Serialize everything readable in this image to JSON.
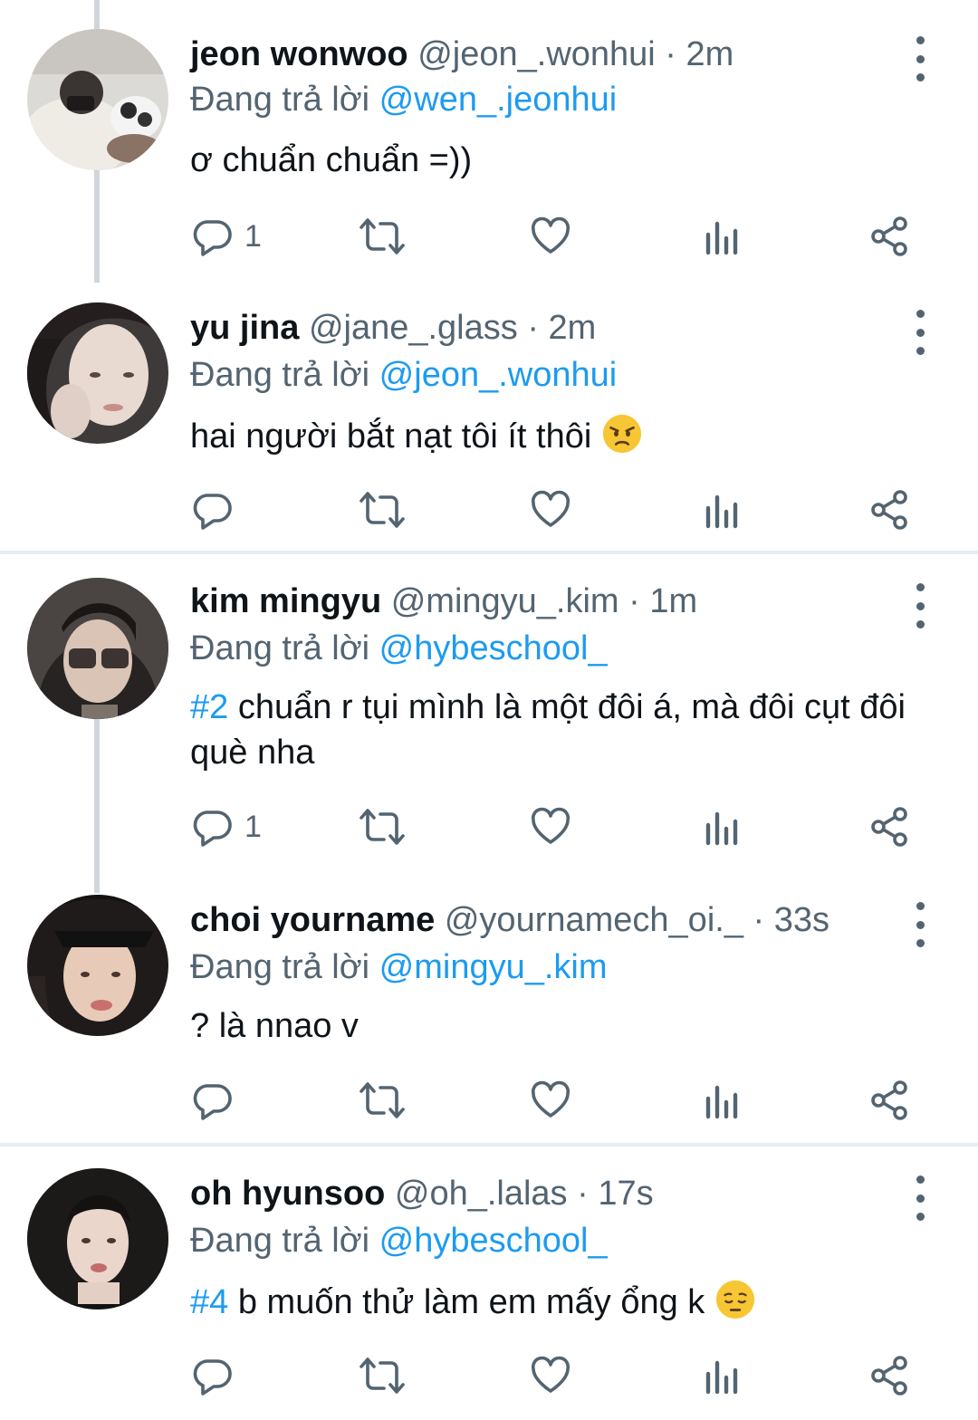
{
  "colors": {
    "link": "#1d9bf0",
    "secondary_text": "#536471",
    "primary_text": "#0f1419",
    "thread_line": "#d0d6da",
    "divider": "#e6ecf0"
  },
  "reply_prefix": "Đang trả lời",
  "icons": [
    "reply-icon",
    "retweet-icon",
    "like-icon",
    "views-icon",
    "share-icon",
    "more-icon"
  ],
  "tweets": [
    {
      "name": "jeon wonwoo",
      "handle": "@jeon_.wonhui",
      "separator": "·",
      "time": "2m",
      "reply_to": "@wen_.jeonhui",
      "text": "ơ chuẩn chuẩn =))",
      "reply_count": "1"
    },
    {
      "name": "yu jina",
      "handle": "@jane_.glass",
      "separator": "·",
      "time": "2m",
      "reply_to": "@jeon_.wonhui",
      "text": "hai người bắt nạt tôi ít thôi",
      "emoji": "angry-face-emoji",
      "reply_count": ""
    },
    {
      "name": "kim mingyu",
      "handle": "@mingyu_.kim",
      "separator": "·",
      "time": "1m",
      "reply_to": "@hybeschool_",
      "hashtag": "#2",
      "text": "chuẩn r tụi mình là một đôi á, mà đôi cụt đôi què nha",
      "reply_count": "1"
    },
    {
      "name": "choi yourname",
      "handle": "@yournamech_oi._",
      "separator": "·",
      "time": "33s",
      "reply_to": "@mingyu_.kim",
      "text": "? là nnao v",
      "reply_count": ""
    },
    {
      "name": "oh hyunsoo",
      "handle": "@oh_.lalas",
      "separator": "·",
      "time": "17s",
      "reply_to": "@hybeschool_",
      "hashtag": "#4",
      "text": "b muốn thử làm em mấy ổng k",
      "emoji": "pensive-face-emoji",
      "reply_count": ""
    }
  ]
}
